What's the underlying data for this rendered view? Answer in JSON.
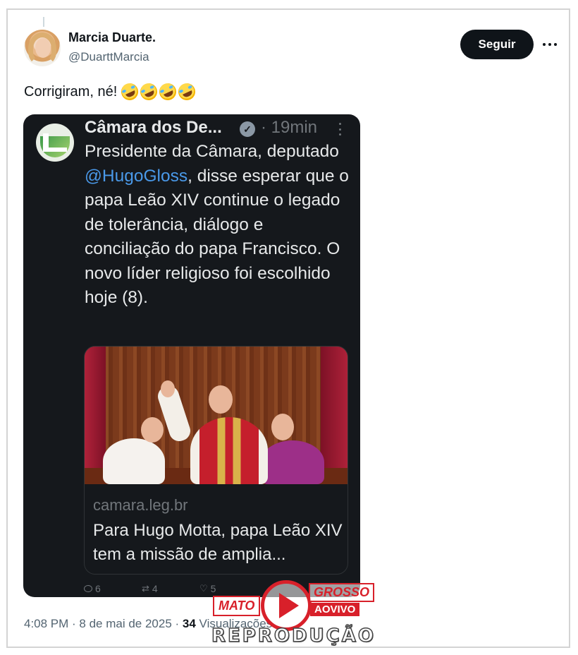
{
  "tweet": {
    "display_name": "Marcia Duarte.",
    "handle": "@DuarttMarcia",
    "follow_label": "Seguir",
    "text": "Corrigiram, né!",
    "emoji_count": 4,
    "emoji_name": "rolling-on-the-floor-laughing",
    "timestamp": "4:08 PM · 8 de mai de 2025 · ",
    "views_count": "34",
    "views_label": " Visualizações"
  },
  "quote": {
    "author": "Câmara dos De...",
    "separator_time": "· 19min",
    "text_before_mention": "Presidente da Câmara, deputado ",
    "mention": "@HugoGloss",
    "text_after_mention": ", disse esperar que o papa Leão XIV continue o legado de tolerância, diálogo e conciliação do papa Francisco. O novo líder religioso foi escolhido hoje (8).",
    "link_domain": "camara.leg.br",
    "link_title": "Para Hugo Motta, papa Leão XIV tem a missão de amplia...",
    "replies": "6",
    "reposts": "4",
    "likes": "5"
  },
  "watermark": {
    "mato": "MATO",
    "grosso": "GROSSO",
    "aovivo": "AOVIVO",
    "reproducao": "REPRODUÇÃO"
  },
  "colors": {
    "follow_bg": "#0f1419",
    "quote_bg": "#15181c",
    "mention": "#4a99e9",
    "watermark_red": "#d8202a"
  }
}
